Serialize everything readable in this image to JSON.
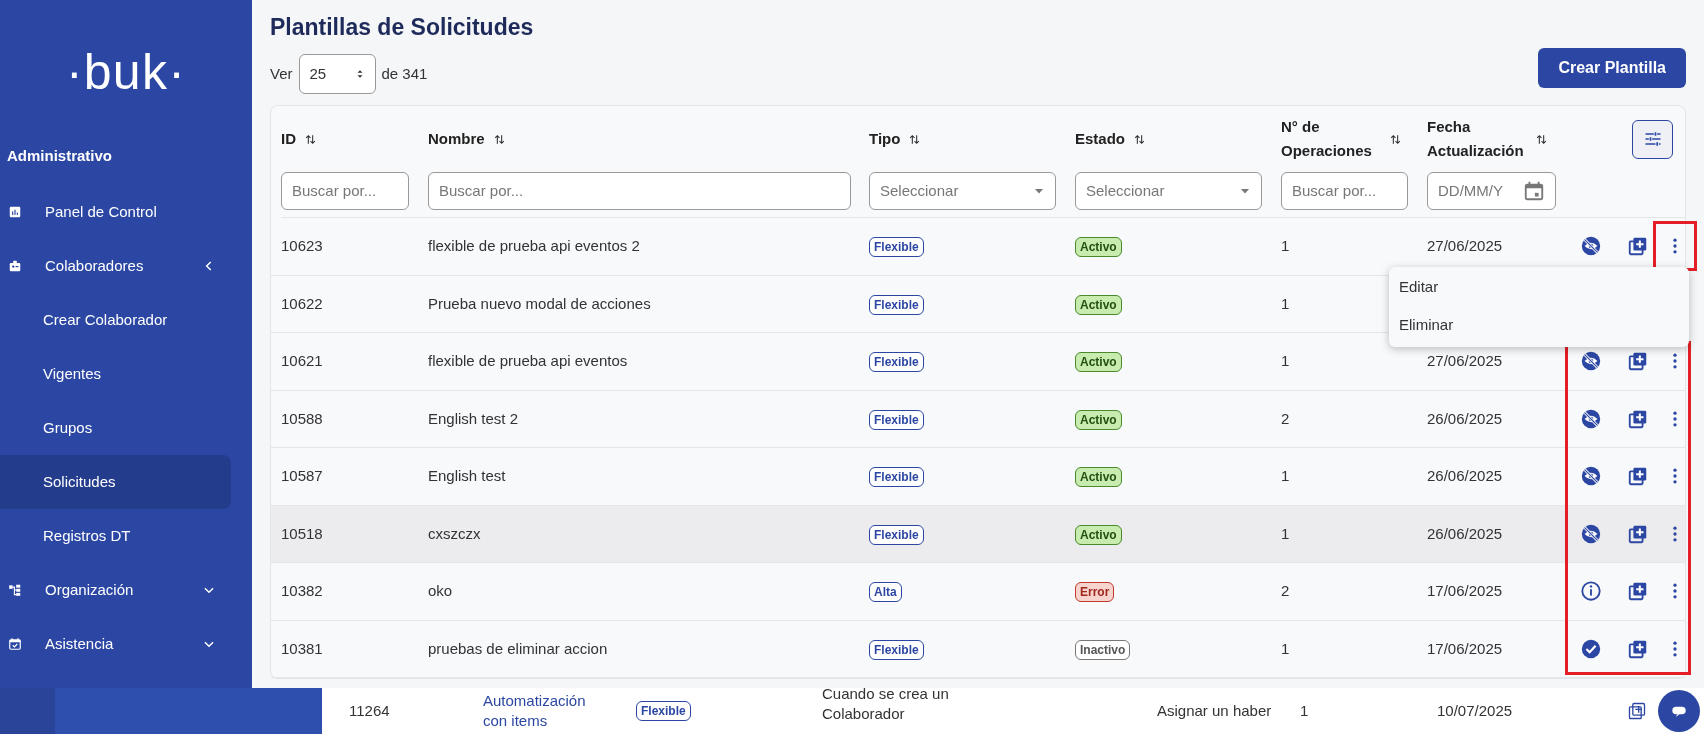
{
  "sidebar": {
    "logo": "·buk·",
    "section": "Administrativo",
    "items": [
      {
        "label": "Panel de Control",
        "selected": false
      },
      {
        "label": "Colaboradores",
        "expanded": true,
        "selected": false,
        "children": [
          {
            "label": "Crear Colaborador",
            "selected": false
          },
          {
            "label": "Vigentes",
            "selected": false
          },
          {
            "label": "Grupos",
            "selected": false
          },
          {
            "label": "Solicitudes",
            "selected": true
          },
          {
            "label": "Registros DT",
            "selected": false
          }
        ]
      },
      {
        "label": "Organización",
        "expanded": false,
        "selected": false
      },
      {
        "label": "Asistencia",
        "expanded": false,
        "selected": false
      }
    ]
  },
  "page": {
    "title": "Plantillas de Solicitudes",
    "show_label": "Ver",
    "page_size": "25",
    "total": "de 341",
    "create_button": "Crear Plantilla"
  },
  "table": {
    "columns": [
      {
        "label": "ID",
        "filter": {
          "kind": "text",
          "placeholder": "Buscar por..."
        }
      },
      {
        "label": "Nombre",
        "filter": {
          "kind": "text",
          "placeholder": "Buscar por..."
        }
      },
      {
        "label": "Tipo",
        "filter": {
          "kind": "select",
          "placeholder": "Seleccionar"
        }
      },
      {
        "label": "Estado",
        "filter": {
          "kind": "select",
          "placeholder": "Seleccionar"
        }
      },
      {
        "label": "N° de Operaciones",
        "filter": {
          "kind": "text",
          "placeholder": "Buscar por..."
        }
      },
      {
        "label": "Fecha Actualización",
        "filter": {
          "kind": "date",
          "placeholder": "DD/MM/Y"
        }
      }
    ],
    "rows": [
      {
        "id": "10623",
        "name": "flexible de prueba api eventos 2",
        "type": "Flexible",
        "status": "Activo",
        "kind": "active",
        "operations": "1",
        "date": "27/06/2025",
        "hovered": false,
        "highlighted": true
      },
      {
        "id": "10622",
        "name": "Prueba nuevo modal de acciones",
        "type": "Flexible",
        "status": "Activo",
        "kind": "active",
        "operations": "1",
        "hovered": false,
        "highlighted": false
      },
      {
        "id": "10621",
        "name": "flexible de prueba api eventos",
        "type": "Flexible",
        "status": "Activo",
        "kind": "active",
        "operations": "1",
        "date": "27/06/2025",
        "hovered": false,
        "highlighted": true
      },
      {
        "id": "10588",
        "name": "English test 2",
        "type": "Flexible",
        "status": "Activo",
        "kind": "active",
        "operations": "2",
        "date": "26/06/2025",
        "hovered": false,
        "highlighted": true
      },
      {
        "id": "10587",
        "name": "English test",
        "type": "Flexible",
        "status": "Activo",
        "kind": "active",
        "operations": "1",
        "date": "26/06/2025",
        "hovered": false,
        "highlighted": true
      },
      {
        "id": "10518",
        "name": "cxszczx",
        "type": "Flexible",
        "status": "Activo",
        "kind": "active",
        "operations": "1",
        "date": "26/06/2025",
        "hovered": true,
        "highlighted": true
      },
      {
        "id": "10382",
        "name": "oko",
        "type": "Alta",
        "status": "Error",
        "kind": "error",
        "operations": "2",
        "date": "17/06/2025",
        "hovered": false,
        "highlighted": true
      },
      {
        "id": "10381",
        "name": "pruebas de eliminar accion",
        "type": "Flexible",
        "status": "Inactivo",
        "kind": "inactive",
        "operations": "1",
        "date": "17/06/2025",
        "hovered": false,
        "highlighted": true
      }
    ],
    "row_menu": [
      "Editar",
      "Eliminar"
    ]
  },
  "underlying_row": {
    "id": "11264",
    "name": "Automatización con items",
    "type": "Flexible",
    "trigger": "Cuando se crea un Colaborador",
    "action": "Asignar un haber",
    "operations": "1",
    "date": "10/07/2025"
  }
}
